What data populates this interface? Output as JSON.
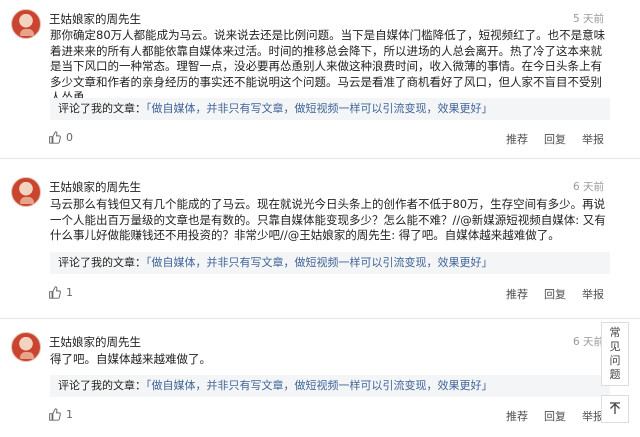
{
  "comments": [
    {
      "author": "王姑娘家的周先生",
      "time": "5 天前",
      "text": "那你确定80万人都能成为马云。说来说去还是比例问题。当下是自媒体门槛降低了，短视频红了。也不是意味着进来来的所有人都能依靠自媒体来过活。时间的推移总会降下，所以进场的人总会离开。热了冷了这本来就是当下风口的一种常态。理智一点，没必要再怂恿别人来做这种浪费时间，收入微薄的事情。在今日头条上有多少文章和作者的亲身经历的事实还不能说明这个问题。马云是看准了商机看好了风口，但人家不盲目不受别人怂恿。",
      "quote_prefix": "评论了我的文章：",
      "quote_title": "「做自媒体，并非只有写文章，做短视频一样可以引流变现，效果更好」",
      "likes": "0",
      "actions": [
        "推荐",
        "回复",
        "举报"
      ]
    },
    {
      "author": "王姑娘家的周先生",
      "time": "6 天前",
      "text": "马云那么有钱但又有几个能成的了马云。现在就说光今日头条上的创作者不低于80万，生存空间有多少。再说一个人能出百万量级的文章也是有数的。只靠自媒体能变现多少？怎么能不难？//@新媒源短视频自媒体: 又有什么事儿好做能赚钱还不用投资的？非常少吧//@王姑娘家的周先生: 得了吧。自媒体越来越难做了。",
      "quote_prefix": "评论了我的文章：",
      "quote_title": "「做自媒体，并非只有写文章，做短视频一样可以引流变现，效果更好」",
      "likes": "1",
      "actions": [
        "推荐",
        "回复",
        "举报"
      ]
    },
    {
      "author": "王姑娘家的周先生",
      "time": "6 天前",
      "text": "得了吧。自媒体越来越难做了。",
      "quote_prefix": "评论了我的文章：",
      "quote_title": "「做自媒体，并非只有写文章，做短视频一样可以引流变现，效果更好」",
      "likes": "1",
      "actions": [
        "推荐",
        "回复",
        "举报"
      ]
    }
  ],
  "help": {
    "chars": [
      "常",
      "见",
      "问",
      "题"
    ]
  },
  "icons": {
    "like": "thumbs-up-icon",
    "back_to_top": "arrow-up-icon"
  },
  "colors": {
    "link": "#406599",
    "quote_bg": "#f4f5f6",
    "muted": "#999999"
  }
}
